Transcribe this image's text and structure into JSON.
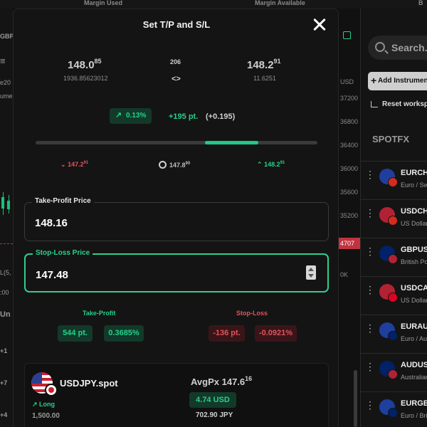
{
  "background": {
    "topbar": {
      "margin_used": "Margin Used",
      "margin_available": "Margin Available",
      "right_label": "B"
    },
    "left_fragments": [
      "GBP",
      "≡",
      "e20",
      "ume",
      "L(5,",
      ":00",
      "Un",
      "+1",
      "+7",
      "+4"
    ],
    "axis_ticks": [
      "USD",
      "37200",
      "36800",
      "36400",
      "36000",
      "35600",
      "35200",
      "0K"
    ],
    "axis_red_tag": "4707",
    "search_placeholder": "Search...",
    "add_instrument": "Add Instrument",
    "reset_workspace": "Reset workspace",
    "section": "SPOTFX",
    "watchlist": [
      {
        "symbol": "EURCHF",
        "name": "Euro / Swiss Franc",
        "c1": "#1f3f9e",
        "c2": "#d52b1e"
      },
      {
        "symbol": "USDCHF",
        "name": "US Dollar / Swiss Franc",
        "c1": "#b22234",
        "c2": "#d52b1e"
      },
      {
        "symbol": "GBPUSD",
        "name": "British Pound / US Dollar",
        "c1": "#012169",
        "c2": "#b22234"
      },
      {
        "symbol": "USDCAD",
        "name": "US Dollar / Canadian Dollar",
        "c1": "#b22234",
        "c2": "#d80621"
      },
      {
        "symbol": "EURAUD",
        "name": "Euro / Australian Dollar",
        "c1": "#1f3f9e",
        "c2": "#012169"
      },
      {
        "symbol": "AUDUSD",
        "name": "Australian Dollar / US Dollar",
        "c1": "#012169",
        "c2": "#b22234"
      },
      {
        "symbol": "EURGBP",
        "name": "Euro / British Pound",
        "c1": "#1f3f9e",
        "c2": "#012169"
      }
    ]
  },
  "modal": {
    "title": "Set T/P and S/L",
    "close_icon": "close-icon",
    "bid": {
      "main": "148.0",
      "sup": "85",
      "sub": "1936.85623012"
    },
    "spread": "206",
    "spread_arrows": "<>",
    "ask": {
      "main": "148.2",
      "sup": "91",
      "sub": "11.6251"
    },
    "change_pct": "0.13%",
    "change_pts": "+195 pt.",
    "change_paren": "(+0.195)",
    "range_fill_fraction": [
      0.6,
      0.79
    ],
    "levels": {
      "low": {
        "main": "147.2",
        "sup": "91"
      },
      "current": {
        "main": "147.8",
        "sup": "90"
      },
      "high": {
        "main": "148.2",
        "sup": "91"
      }
    },
    "take_profit": {
      "label": "Take-Profit Price",
      "value": "148.16"
    },
    "stop_loss": {
      "label": "Stop-Loss Price",
      "value": "147.48"
    },
    "tp_result": {
      "title": "Take-Profit",
      "pts": "544 pt.",
      "pct": "0.3685%"
    },
    "sl_result": {
      "title": "Stop-Loss",
      "pts": "-136 pt.",
      "pct": "-0.0921%"
    },
    "position": {
      "symbol": "USDJPY.spot",
      "side": "Long",
      "quantity": "1,500.00",
      "avgpx_label": "AvgPx",
      "avgpx_main": "147.6",
      "avgpx_sup": "16",
      "pnl_usd": "4.74 USD",
      "pnl_jpy": "702.90 JPY"
    }
  },
  "colors": {
    "green": "#23d28a",
    "red": "#e0545d",
    "accent_border": "#2fd08f"
  }
}
